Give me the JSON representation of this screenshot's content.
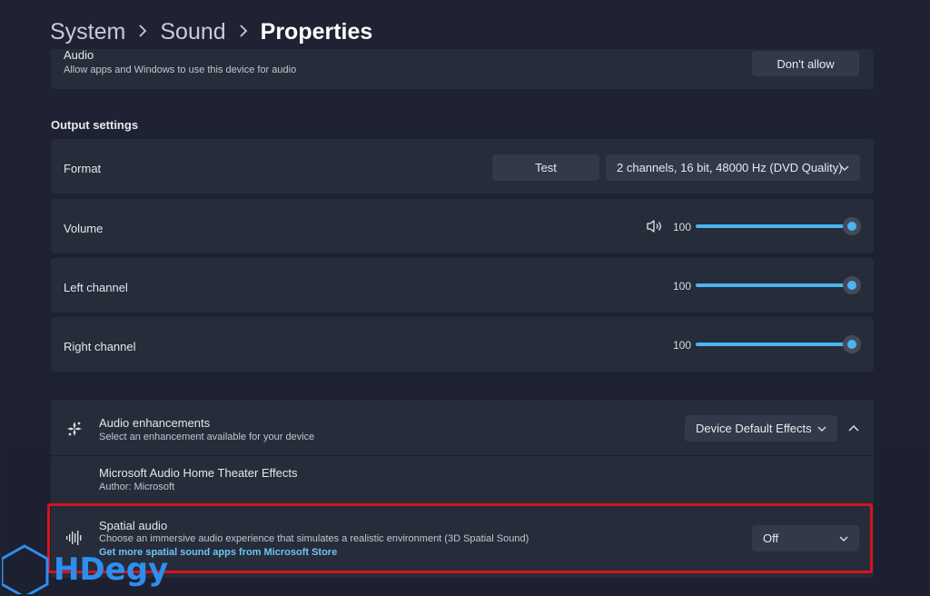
{
  "breadcrumb": {
    "items": [
      "System",
      "Sound",
      "Properties"
    ]
  },
  "audio_access": {
    "label": "Audio",
    "description": "Allow apps and Windows to use this device for audio",
    "button_label": "Don't allow"
  },
  "output_settings": {
    "header": "Output settings",
    "format": {
      "label": "Format",
      "test_button": "Test",
      "selected": "2 channels, 16 bit, 48000 Hz (DVD Quality)"
    },
    "volume": {
      "label": "Volume",
      "value": "100",
      "level": 100
    },
    "left_channel": {
      "label": "Left channel",
      "value": "100",
      "level": 100
    },
    "right_channel": {
      "label": "Right channel",
      "value": "100",
      "level": 100
    }
  },
  "enhancements": {
    "title": "Audio enhancements",
    "description": "Select an enhancement available for your device",
    "selected": "Device Default Effects",
    "effect": {
      "title": "Microsoft Audio Home Theater Effects",
      "author": "Author: Microsoft"
    }
  },
  "spatial_audio": {
    "title": "Spatial audio",
    "description": "Choose an immersive audio experience that simulates a realistic environment (3D Spatial Sound)",
    "link": "Get more spatial sound apps from Microsoft Store",
    "selected": "Off"
  },
  "watermark": {
    "text": "HDegy"
  },
  "colors": {
    "accent": "#4cb4f0",
    "highlight": "#d6121f",
    "card": "#272c3a",
    "watermark": "#2e8ef0"
  }
}
